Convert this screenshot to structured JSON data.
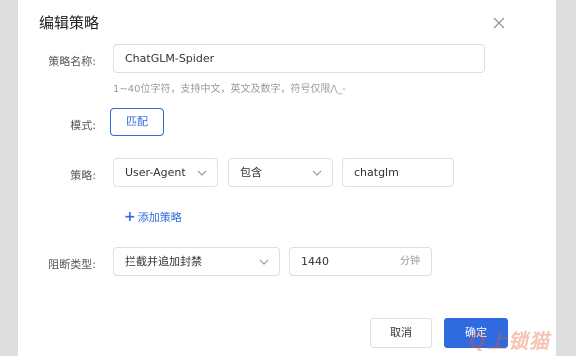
{
  "dialog": {
    "title": "编辑策略",
    "close_icon": "close-icon"
  },
  "form": {
    "name": {
      "label": "策略名称:",
      "value": "ChatGLM-Spider",
      "hint": "1~40位字符，支持中文，英文及数字，符号仅限/\\_-"
    },
    "mode": {
      "label": "模式:",
      "value": "匹配"
    },
    "strategy": {
      "label": "策略:",
      "field": "User-Agent",
      "operator": "包含",
      "value": "chatglm"
    },
    "add_strategy": {
      "icon": "plus-icon",
      "label": "添加策略"
    },
    "block_type": {
      "label": "阻断类型:",
      "value": "拦截并追加封禁",
      "duration": "1440",
      "unit": "分钟"
    }
  },
  "footer": {
    "cancel_label": "取消",
    "ok_label": "确定"
  },
  "watermark": "Q上锁猫",
  "colors": {
    "accent": "#2f6bdf",
    "border": "#dcdfe6",
    "backdrop": "#dcdcdc"
  }
}
